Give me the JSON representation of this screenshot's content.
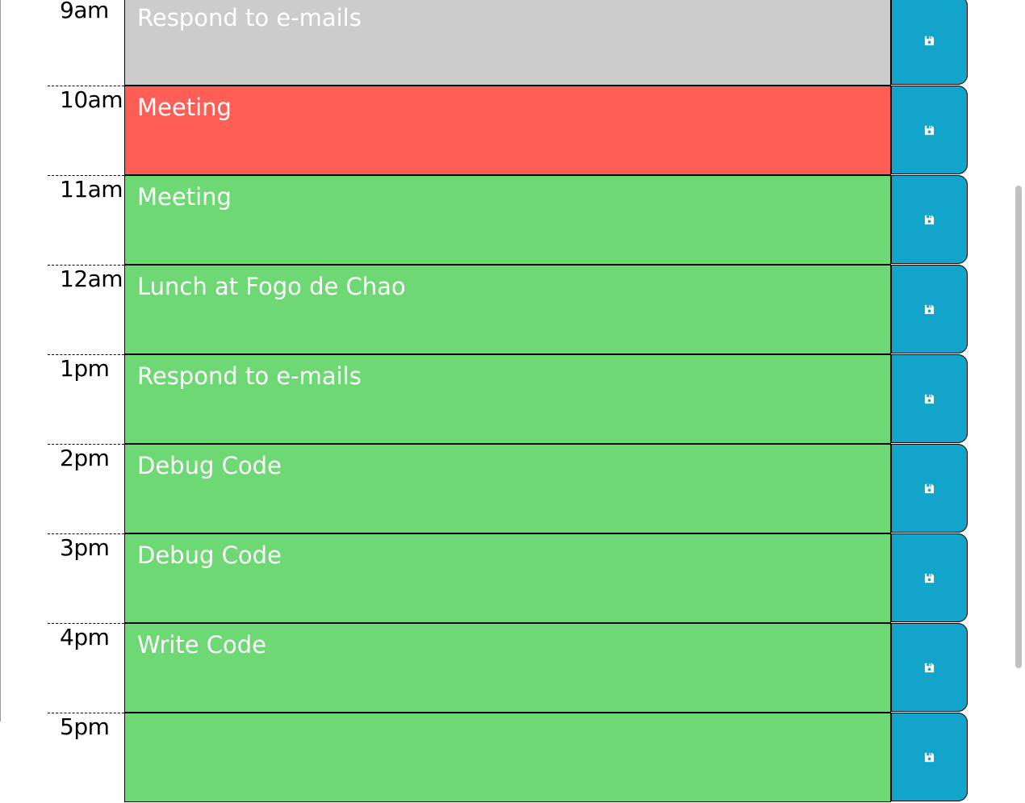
{
  "colors": {
    "past": "#cccccc",
    "present": "#ff5e57",
    "future": "#6ed874",
    "save_button": "#13a4cb"
  },
  "rows": [
    {
      "hour": "9am",
      "task": "Respond to e-mails",
      "state": "past",
      "save_icon": "save-icon"
    },
    {
      "hour": "10am",
      "task": "Meeting",
      "state": "present",
      "save_icon": "save-icon"
    },
    {
      "hour": "11am",
      "task": "Meeting",
      "state": "future",
      "save_icon": "save-icon"
    },
    {
      "hour": "12am",
      "task": "Lunch at Fogo de Chao",
      "state": "future",
      "save_icon": "save-icon"
    },
    {
      "hour": "1pm",
      "task": "Respond to e-mails",
      "state": "future",
      "save_icon": "save-icon"
    },
    {
      "hour": "2pm",
      "task": "Debug Code",
      "state": "future",
      "save_icon": "save-icon"
    },
    {
      "hour": "3pm",
      "task": "Debug Code",
      "state": "future",
      "save_icon": "save-icon"
    },
    {
      "hour": "4pm",
      "task": "Write Code",
      "state": "future",
      "save_icon": "save-icon"
    },
    {
      "hour": "5pm",
      "task": "",
      "state": "future",
      "save_icon": "save-icon"
    }
  ]
}
